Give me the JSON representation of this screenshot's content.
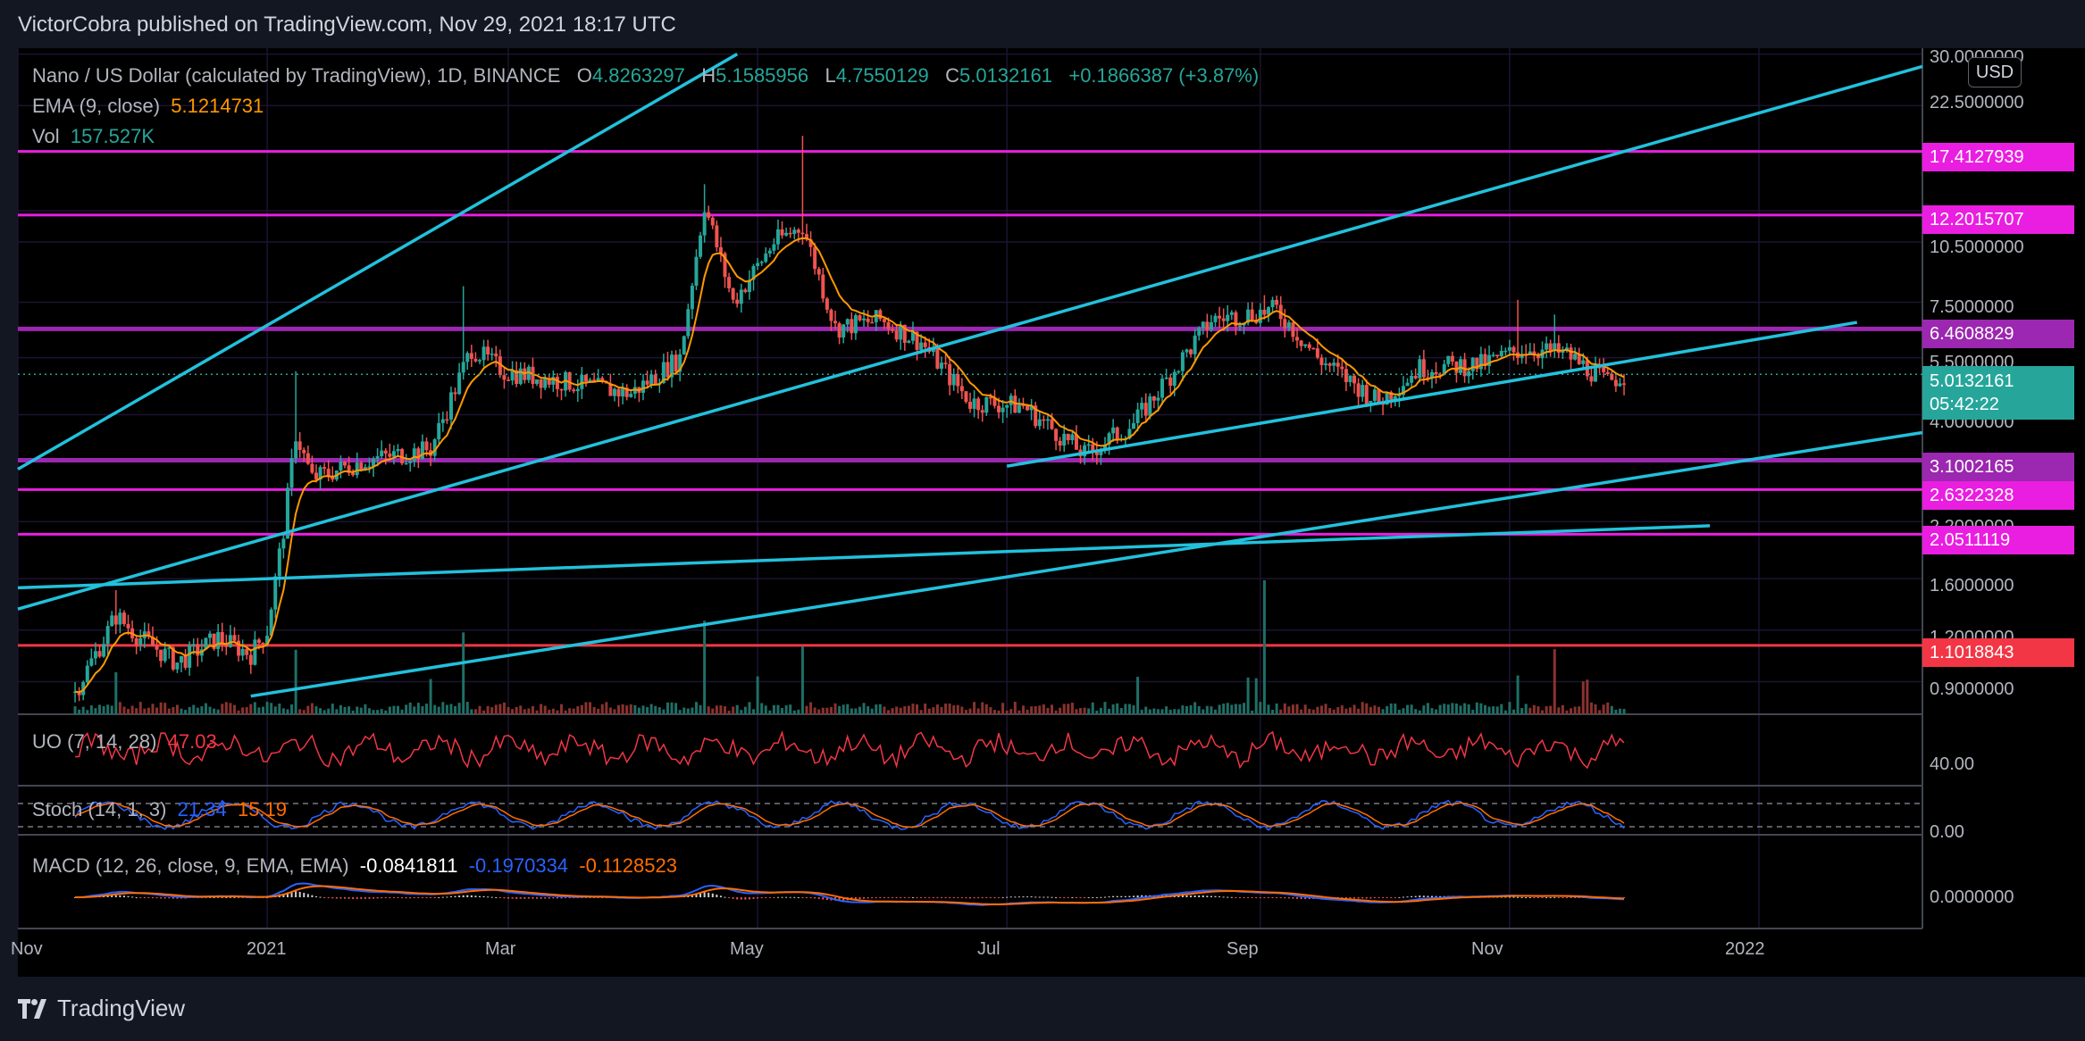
{
  "header": {
    "published": "VictorCobra published on TradingView.com, Nov 29, 2021 18:17 UTC"
  },
  "legend": {
    "symbol": "Nano / US Dollar (calculated by TradingView), 1D, BINANCE",
    "o_label": "O",
    "o": "4.8263297",
    "h_label": "H",
    "h": "5.1585956",
    "l_label": "L",
    "l": "4.7550129",
    "c_label": "C",
    "c": "5.0132161",
    "change": "+0.1866387 (+3.87%)",
    "ema_label": "EMA (9, close)",
    "ema": "5.1214731",
    "vol_label": "Vol",
    "vol": "157.527K"
  },
  "axis": {
    "currency": "USD",
    "price_ticks": [
      "30.0000000",
      "22.5000000",
      "10.5000000",
      "7.5000000",
      "5.5000000",
      "4.0000000",
      "2.2000000",
      "1.6000000",
      "1.2000000",
      "0.9000000"
    ],
    "x_ticks": [
      "Nov",
      "2021",
      "Mar",
      "May",
      "Jul",
      "Sep",
      "Nov",
      "2022"
    ],
    "current_price": "5.0132161",
    "countdown": "05:42:22"
  },
  "levels": [
    {
      "value": "17.4127939",
      "color": "#e91ee0"
    },
    {
      "value": "12.2015707",
      "color": "#e91ee0"
    },
    {
      "value": "6.4608829",
      "color": "#9c27b0"
    },
    {
      "value": "3.1002165",
      "color": "#9c27b0"
    },
    {
      "value": "2.6322328",
      "color": "#e91ee0"
    },
    {
      "value": "2.0511119",
      "color": "#e91ee0"
    },
    {
      "value": "1.1018843",
      "color": "#f23645"
    }
  ],
  "indicators": {
    "uo_label": "UO (7, 14, 28)",
    "uo": "47.03",
    "uo_tick": "40.00",
    "stoch_label": "Stoch (14, 1, 3)",
    "stoch_k": "21.34",
    "stoch_d": "15.19",
    "stoch_tick": "0.00",
    "macd_label": "MACD (12, 26, close, 9, EMA, EMA)",
    "macd_hist": "-0.0841811",
    "macd": "-0.1970334",
    "macd_signal": "-0.1128523",
    "macd_tick": "0.0000000"
  },
  "footer": {
    "brand": "TradingView"
  },
  "colors": {
    "up": "#26a69a",
    "down": "#ef5350",
    "ema": "#ff9800",
    "trend": "#22c1dc",
    "uo": "#f23645",
    "stoch_k": "#2962ff",
    "stoch_d": "#ff6d00",
    "macd": "#2962ff",
    "signal": "#ff6d00"
  },
  "chart_data": {
    "type": "candlestick",
    "title": "Nano / US Dollar (calculated by TradingView), 1D, BINANCE",
    "x_range": [
      "2020-11-01",
      "2022-02-10"
    ],
    "y_scale": "log",
    "ylim": [
      0.75,
      31
    ],
    "price_path": [
      [
        "2020-11-15",
        0.85
      ],
      [
        "2020-11-25",
        1.3
      ],
      [
        "2020-12-01",
        1.15
      ],
      [
        "2020-12-10",
        1.0
      ],
      [
        "2020-12-20",
        1.15
      ],
      [
        "2020-12-28",
        1.05
      ],
      [
        "2021-01-01",
        1.2
      ],
      [
        "2021-01-05",
        2.1
      ],
      [
        "2021-01-08",
        3.6
      ],
      [
        "2021-01-12",
        2.8
      ],
      [
        "2021-01-25",
        3.1
      ],
      [
        "2021-02-10",
        3.3
      ],
      [
        "2021-02-20",
        5.8
      ],
      [
        "2021-02-28",
        5.1
      ],
      [
        "2021-03-15",
        4.8
      ],
      [
        "2021-03-31",
        4.5
      ],
      [
        "2021-04-12",
        5.5
      ],
      [
        "2021-04-18",
        13.0
      ],
      [
        "2021-04-25",
        7.5
      ],
      [
        "2021-05-05",
        10.5
      ],
      [
        "2021-05-12",
        11.5
      ],
      [
        "2021-05-20",
        6.5
      ],
      [
        "2021-05-31",
        6.8
      ],
      [
        "2021-06-10",
        6.0
      ],
      [
        "2021-06-22",
        4.3
      ],
      [
        "2021-07-05",
        4.2
      ],
      [
        "2021-07-20",
        3.2
      ],
      [
        "2021-08-01",
        3.8
      ],
      [
        "2021-08-10",
        5.0
      ],
      [
        "2021-08-20",
        6.8
      ],
      [
        "2021-09-05",
        7.2
      ],
      [
        "2021-09-15",
        5.5
      ],
      [
        "2021-09-30",
        4.3
      ],
      [
        "2021-10-10",
        5.2
      ],
      [
        "2021-10-25",
        5.3
      ],
      [
        "2021-11-05",
        5.8
      ],
      [
        "2021-11-15",
        5.6
      ],
      [
        "2021-11-25",
        4.8
      ],
      [
        "2021-11-29",
        5.0132161
      ]
    ],
    "spikes": [
      [
        "2020-11-25",
        1.5
      ],
      [
        "2021-01-08",
        5.1
      ],
      [
        "2021-02-18",
        8.2
      ],
      [
        "2021-04-18",
        14.5
      ],
      [
        "2021-05-12",
        19.0
      ],
      [
        "2021-09-02",
        7.8
      ],
      [
        "2021-11-03",
        7.6
      ],
      [
        "2021-11-12",
        7.0
      ]
    ],
    "horizontal_levels": [
      17.4127939,
      12.2015707,
      6.4608829,
      3.1002165,
      2.6322328,
      2.0511119,
      1.1018843
    ],
    "trendlines": [
      {
        "from": [
          "2020-11-01",
          2.95
        ],
        "to": [
          "2021-04-26",
          30.0
        ]
      },
      {
        "from": [
          "2020-11-01",
          1.35
        ],
        "to": [
          "2022-02-10",
          28.0
        ]
      },
      {
        "from": [
          "2020-11-01",
          1.52
        ],
        "to": [
          "2021-12-20",
          2.15
        ]
      },
      {
        "from": [
          "2020-12-28",
          0.83
        ],
        "to": [
          "2022-02-10",
          3.62
        ]
      },
      {
        "from": [
          "2021-07-01",
          3.0
        ],
        "to": [
          "2022-01-25",
          6.7
        ]
      }
    ]
  }
}
